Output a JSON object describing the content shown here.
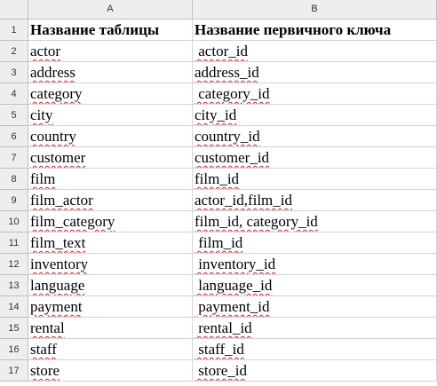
{
  "columns": [
    "A",
    "B"
  ],
  "headers": {
    "num": "1",
    "a": "Название таблицы",
    "b": "Название первичного ключа"
  },
  "rows": [
    {
      "num": "2",
      "a": "actor",
      "b": " actor_id"
    },
    {
      "num": "3",
      "a": "address",
      "b": "address_id"
    },
    {
      "num": "4",
      "a": "category",
      "b": " category_id"
    },
    {
      "num": "5",
      "a": "city",
      "b": "city_id"
    },
    {
      "num": "6",
      "a": "country",
      "b": "country_id"
    },
    {
      "num": "7",
      "a": "customer",
      "b": "customer_id"
    },
    {
      "num": "8",
      "a": "film",
      "b": "film_id"
    },
    {
      "num": "9",
      "a": "film_actor",
      "b": "actor_id,film_id"
    },
    {
      "num": "10",
      "a": "film_category",
      "b": "film_id, category_id"
    },
    {
      "num": "11",
      "a": "film_text",
      "b": " film_id"
    },
    {
      "num": "12",
      "a": "inventory",
      "b": " inventory_id"
    },
    {
      "num": "13",
      "a": "language",
      "b": " language_id"
    },
    {
      "num": "14",
      "a": "payment",
      "b": " payment_id"
    },
    {
      "num": "15",
      "a": "rental",
      "b": " rental_id"
    },
    {
      "num": "16",
      "a": "staff",
      "b": " staff_id"
    },
    {
      "num": "17",
      "a": "store",
      "b": " store_id"
    }
  ],
  "colors": {
    "header_bg": "#eeeeee",
    "grid": "#d4d4d4",
    "spellcheck": "#d02020"
  }
}
